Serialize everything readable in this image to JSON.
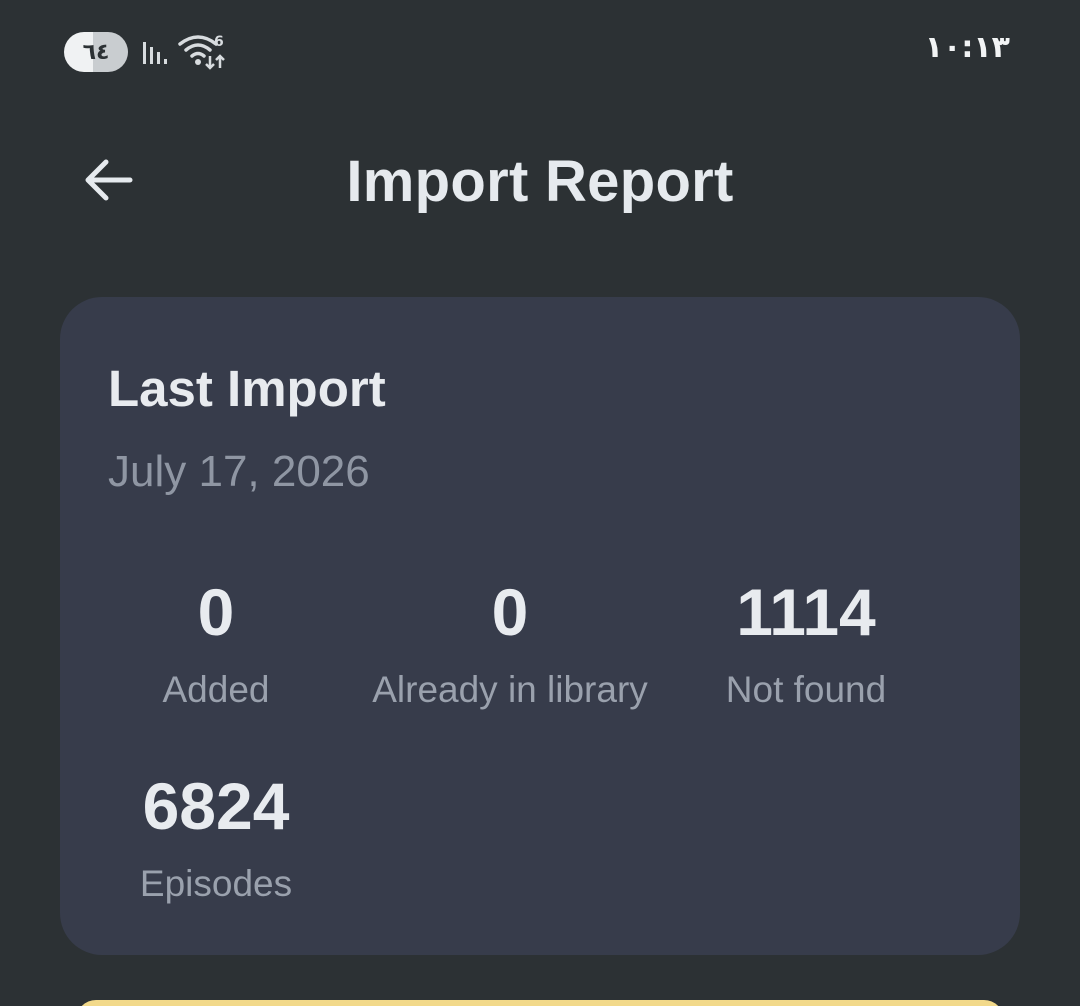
{
  "status_bar": {
    "battery_level": "٦٤",
    "time": "١٠:١٣",
    "signal_icon": "signal-bars-icon",
    "wifi_icon": "wifi-data-icon"
  },
  "app_bar": {
    "back_icon": "arrow-left-icon",
    "title": "Import Report"
  },
  "card": {
    "title": "Last Import",
    "date": "July 17, 2026",
    "stats": [
      {
        "value": "0",
        "label": "Added"
      },
      {
        "value": "0",
        "label": "Already in library"
      },
      {
        "value": "1114",
        "label": "Not found"
      },
      {
        "value": "6824",
        "label": "Episodes"
      }
    ]
  },
  "colors": {
    "background": "#2c3134",
    "card": "#373c4b",
    "accent_peek": "#f2d98a"
  }
}
